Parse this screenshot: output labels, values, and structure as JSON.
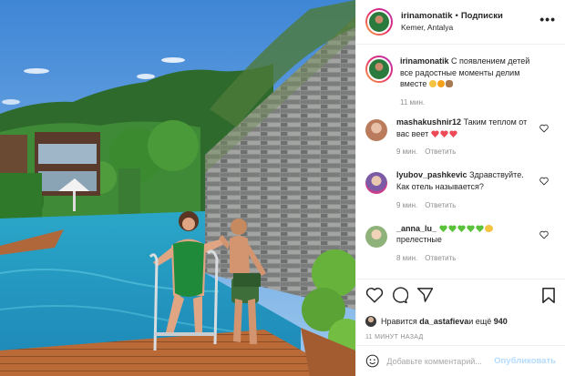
{
  "post": {
    "username": "irinamonatik",
    "separator": "•",
    "follow_label": "Подписки",
    "location": "Kemer, Antalya",
    "more_label": "•••"
  },
  "caption": {
    "username": "irinamonatik",
    "text": "С появлением детей все радостные моменты делим вместе",
    "time": "11 мин."
  },
  "comments": [
    {
      "username": "mashakushnir12",
      "text": "Таким теплом от вас веет",
      "time": "9 мин.",
      "reply_label": "Ответить",
      "avatar_color": "#d8a68a"
    },
    {
      "username": "lyubov_pashkevic",
      "text": "Здравствуйте. Как отель называется?",
      "time": "9 мин.",
      "reply_label": "Ответить",
      "avatar_color": "#9a7bbd"
    },
    {
      "username": "_anna_lu_",
      "text": "прелестные",
      "time": "8 мин.",
      "reply_label": "Ответить",
      "avatar_color": "#b9c8a2"
    }
  ],
  "likes": {
    "prefix": "Нравится ",
    "user": "da_astafieva",
    "middle": " и ещё ",
    "count": "940"
  },
  "posted_ago": "11 МИНУТ НАЗАД",
  "add_comment": {
    "placeholder": "Добавьте комментарий...",
    "publish_label": "Опубликовать"
  },
  "colors": {
    "heart_red": "#ed4956",
    "green_heart": "#5ac23a",
    "link_disabled": "#b3dbff",
    "muted": "#8e8e8e"
  }
}
